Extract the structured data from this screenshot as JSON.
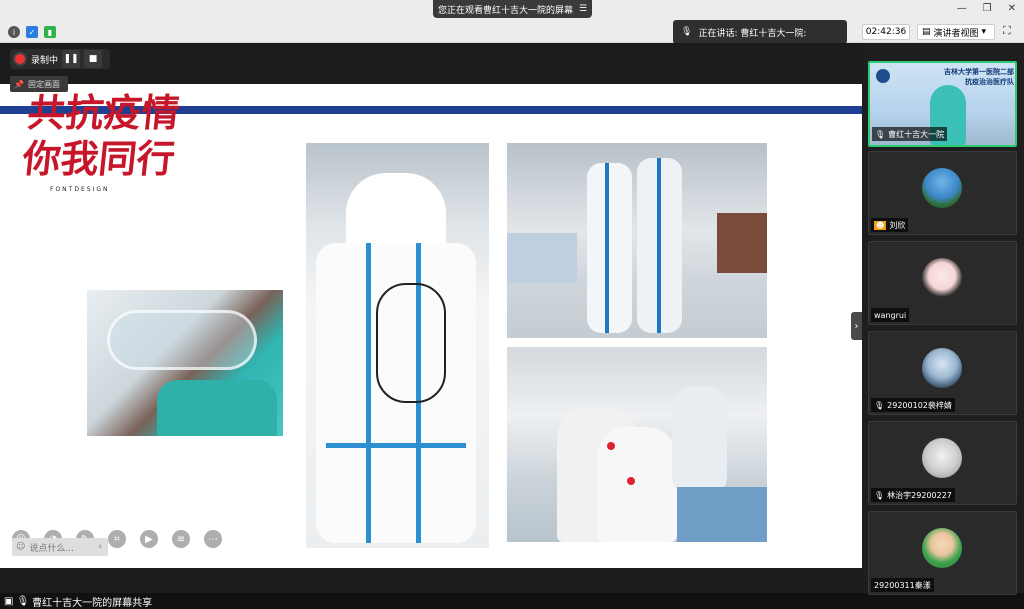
{
  "topbar": {
    "watching_text": "您正在观看曹红十吉大一院的屏幕",
    "speaking_text": "正在讲话: 曹红十吉大一院:",
    "clock": "02:42:36",
    "presenter_view": "演讲者视图"
  },
  "recording": {
    "label": "录制中",
    "pin_label": "固定画面"
  },
  "slide": {
    "title_line1": "共抗疫情",
    "title_line2": "你我同行",
    "font_design": "FONTDESIGN"
  },
  "comment": {
    "placeholder": "说点什么..."
  },
  "bottom_bar": {
    "share_text": "曹红十吉大一院的屏幕共享"
  },
  "participants": [
    {
      "name": "曹红十吉大一院",
      "banner_line1": "吉林大学第一医院二部",
      "banner_line2": "抗疫治治医疗队"
    },
    {
      "name": "刘欣"
    },
    {
      "name": "wangrui"
    },
    {
      "name": "29200102裴梓婧"
    },
    {
      "name": "林治宇29200227"
    },
    {
      "name": "29200311秦漾"
    }
  ],
  "colors": {
    "accent": "#2ecc71",
    "title_red": "#c6172a",
    "slide_blue": "#1f3f93"
  }
}
